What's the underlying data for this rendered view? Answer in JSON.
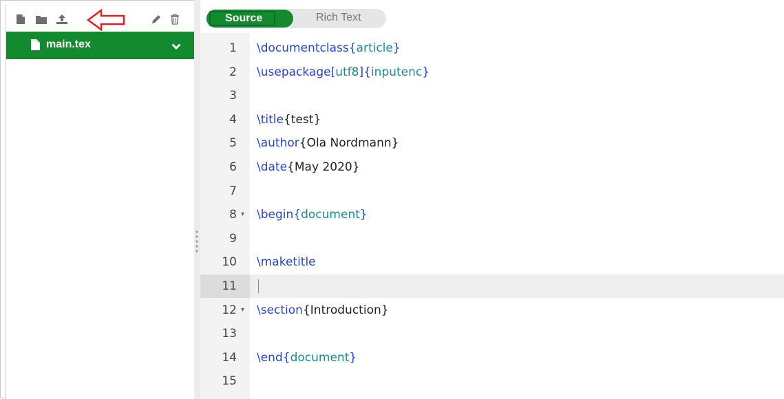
{
  "sidebar": {
    "toolbar_icons": [
      "new-file-icon",
      "new-folder-icon",
      "upload-icon",
      "rename-icon",
      "delete-icon"
    ],
    "files": [
      {
        "name": "main.tex",
        "selected": true
      }
    ]
  },
  "editor_tabs": {
    "source_label": "Source",
    "rich_label": "Rich Text",
    "active": "Source"
  },
  "editor": {
    "active_line": 11,
    "lines": [
      {
        "n": "1",
        "kw": "\\documentclass",
        "rest": "",
        "arg": "article"
      },
      {
        "n": "2",
        "kw": "\\usepackage",
        "opt": "utf8",
        "arg": "inputenc"
      },
      {
        "n": "3"
      },
      {
        "n": "4",
        "kw": "\\title",
        "plain": "test"
      },
      {
        "n": "5",
        "kw": "\\author",
        "plain": "Ola Nordmann"
      },
      {
        "n": "6",
        "kw": "\\date",
        "plain": "May 2020"
      },
      {
        "n": "7"
      },
      {
        "n": "8",
        "kw": "\\begin",
        "arg": "document",
        "fold": true
      },
      {
        "n": "9"
      },
      {
        "n": "10",
        "kw": "\\maketitle"
      },
      {
        "n": "11"
      },
      {
        "n": "12",
        "kw": "\\section",
        "plain": "Introduction",
        "fold": true
      },
      {
        "n": "13"
      },
      {
        "n": "14",
        "kw": "\\end",
        "arg": "document"
      },
      {
        "n": "15"
      }
    ]
  },
  "colors": {
    "accent": "#138a2e",
    "keyword": "#2546c9",
    "argument": "#1b8b8b",
    "annotation_arrow": "#e02020"
  }
}
